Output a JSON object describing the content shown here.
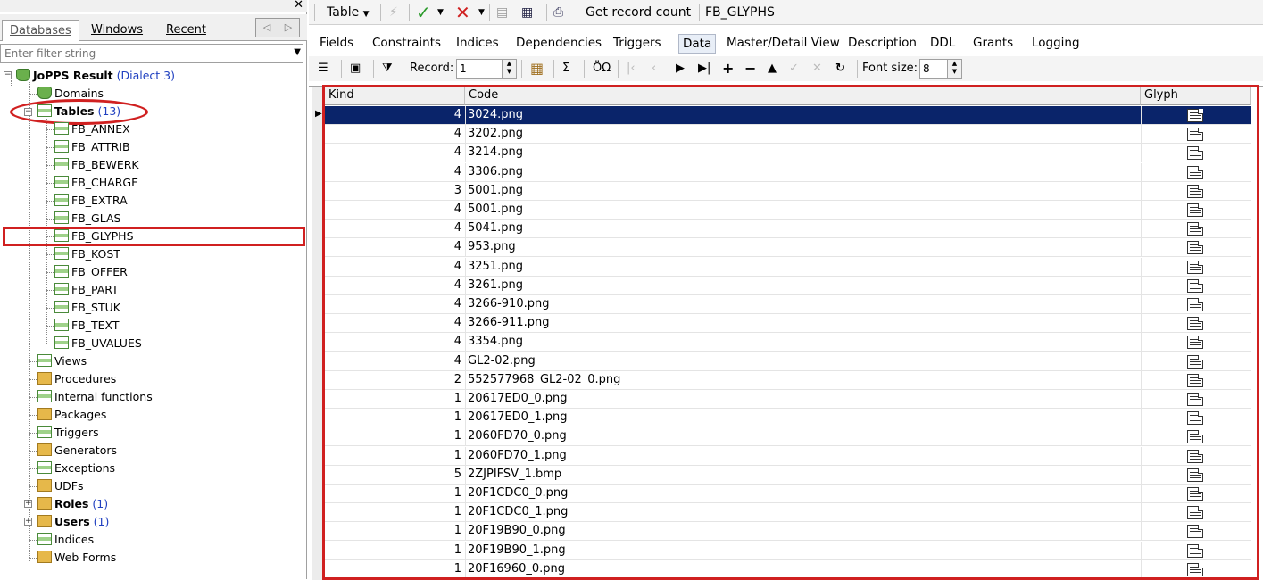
{
  "left_panel": {
    "tabs": [
      "Databases",
      "Windows",
      "Recent"
    ],
    "filter_placeholder": "Enter filter string",
    "root": {
      "label": "JoPPS Result",
      "suffix": "(Dialect 3)"
    },
    "domains": "Domains",
    "tables": {
      "label": "Tables",
      "count": "(13)"
    },
    "table_items": [
      "FB_ANNEX",
      "FB_ATTRIB",
      "FB_BEWERK",
      "FB_CHARGE",
      "FB_EXTRA",
      "FB_GLAS",
      "FB_GLYPHS",
      "FB_KOST",
      "FB_OFFER",
      "FB_PART",
      "FB_STUK",
      "FB_TEXT",
      "FB_UVALUES"
    ],
    "other_items": [
      "Views",
      "Procedures",
      "Internal functions",
      "Packages",
      "Triggers",
      "Generators",
      "Exceptions",
      "UDFs"
    ],
    "roles": {
      "label": "Roles",
      "count": "(1)"
    },
    "users": {
      "label": "Users",
      "count": "(1)"
    },
    "tail_items": [
      "Indices",
      "Web Forms"
    ]
  },
  "toolbar": {
    "table_menu": "Table",
    "get_record_count": "Get record count",
    "object_name": "FB_GLYPHS"
  },
  "object_tabs": [
    "Fields",
    "Constraints",
    "Indices",
    "Dependencies",
    "Triggers",
    "Data",
    "Master/Detail View",
    "Description",
    "DDL",
    "Grants",
    "Logging"
  ],
  "active_tab": "Data",
  "data_toolbar": {
    "record_label": "Record:",
    "record_value": "1",
    "sigma": "Σ",
    "oo": "ÖΩ",
    "font_size_label": "Font size:",
    "font_size_value": "8"
  },
  "grid": {
    "columns": [
      "Kind",
      "Code",
      "Glyph"
    ],
    "rows": [
      {
        "kind": "4",
        "code": "3024.png"
      },
      {
        "kind": "4",
        "code": "3202.png"
      },
      {
        "kind": "4",
        "code": "3214.png"
      },
      {
        "kind": "4",
        "code": "3306.png"
      },
      {
        "kind": "3",
        "code": "5001.png"
      },
      {
        "kind": "4",
        "code": "5001.png"
      },
      {
        "kind": "4",
        "code": "5041.png"
      },
      {
        "kind": "4",
        "code": "953.png"
      },
      {
        "kind": "4",
        "code": "3251.png"
      },
      {
        "kind": "4",
        "code": "3261.png"
      },
      {
        "kind": "4",
        "code": "3266-910.png"
      },
      {
        "kind": "4",
        "code": "3266-911.png"
      },
      {
        "kind": "4",
        "code": "3354.png"
      },
      {
        "kind": "4",
        "code": "GL2-02.png"
      },
      {
        "kind": "2",
        "code": "552577968_GL2-02_0.png"
      },
      {
        "kind": "1",
        "code": "20617ED0_0.png"
      },
      {
        "kind": "1",
        "code": "20617ED0_1.png"
      },
      {
        "kind": "1",
        "code": "2060FD70_0.png"
      },
      {
        "kind": "1",
        "code": "2060FD70_1.png"
      },
      {
        "kind": "5",
        "code": "2ZJPIFSV_1.bmp"
      },
      {
        "kind": "1",
        "code": "20F1CDC0_0.png"
      },
      {
        "kind": "1",
        "code": "20F1CDC0_1.png"
      },
      {
        "kind": "1",
        "code": "20F19B90_0.png"
      },
      {
        "kind": "1",
        "code": "20F19B90_1.png"
      },
      {
        "kind": "1",
        "code": "20F16960_0.png"
      }
    ]
  },
  "colors": {
    "highlight": "#d02020",
    "selection": "#0a246a",
    "count": "#2040c0"
  }
}
